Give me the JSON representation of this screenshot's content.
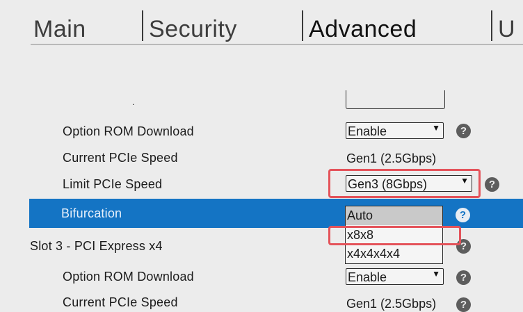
{
  "tabs": [
    {
      "label": "Main"
    },
    {
      "label": "Security"
    },
    {
      "label": "Advanced"
    },
    {
      "label": "U"
    }
  ],
  "active_tab": "Advanced",
  "rows": {
    "option_rom_1": {
      "label": "Option ROM Download",
      "value": "Enable"
    },
    "current_speed_1": {
      "label": "Current PCIe Speed",
      "value": "Gen1 (2.5Gbps)"
    },
    "limit_speed": {
      "label": "Limit PCIe Speed",
      "value": "Gen3 (8Gbps)"
    },
    "bifurcation": {
      "label": "Bifurcation",
      "options": [
        "Auto",
        "x8x8",
        "x4x4x4x4"
      ],
      "selected": "Auto"
    },
    "slot3_header": {
      "label": "Slot 3 - PCI Express x4"
    },
    "option_rom_2": {
      "label": "Option ROM Download",
      "value": "Enable"
    },
    "current_speed_2": {
      "label": "Current PCIe Speed",
      "value": "Gen1 (2.5Gbps)"
    }
  },
  "icons": {
    "help": "?",
    "caret": "▼"
  },
  "colors": {
    "highlight": "#1474c4",
    "callout": "#e4535a",
    "background": "#ececec"
  }
}
